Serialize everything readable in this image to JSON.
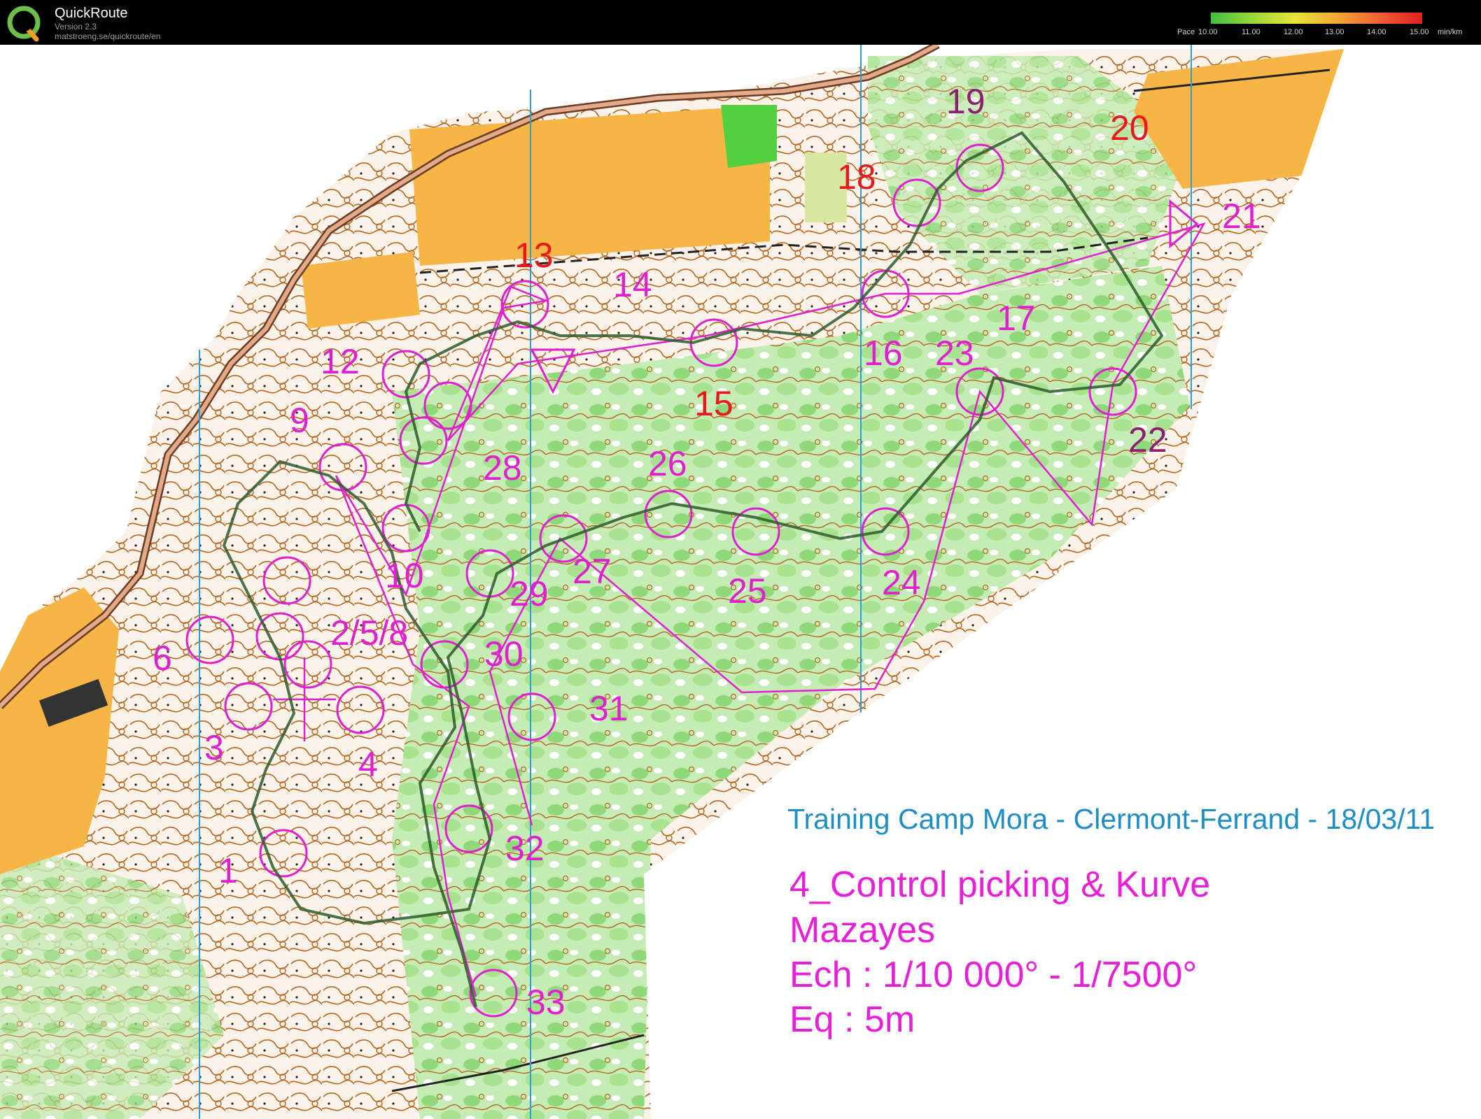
{
  "app": {
    "title": "QuickRoute",
    "version": "Version 2.3",
    "url": "matstroeng.se/quickroute/en"
  },
  "pace_legend": {
    "label": "Pace",
    "ticks": [
      "10.00",
      "11.00",
      "12.00",
      "13.00",
      "14.00",
      "15.00"
    ],
    "unit": "min/km",
    "colors": [
      "#3fbf3f",
      "#9bd93a",
      "#e8e23a",
      "#f5a637",
      "#f06030",
      "#e02020"
    ]
  },
  "map": {
    "title": "Training Camp Mora - Clermont-Ferrand - 18/03/11",
    "lines": [
      "4_Control picking & Kurve",
      "Mazayes",
      "Ech : 1/10 000° - 1/7500°",
      "Eq : 5m"
    ],
    "colors": {
      "course": "#e020d0",
      "route": "#2d5a2d",
      "forest": "#7ed46b",
      "field": "#f6b544",
      "contour": "#a0522d",
      "road": "#c47a5a",
      "meridian": "#2aa0d8"
    },
    "controls": [
      {
        "label": "1",
        "style": "ctl-num"
      },
      {
        "label": "2/5/8",
        "style": "ctl-num"
      },
      {
        "label": "3",
        "style": "ctl-num"
      },
      {
        "label": "4",
        "style": "ctl-num"
      },
      {
        "label": "6",
        "style": "ctl-num"
      },
      {
        "label": "9",
        "style": "ctl-num"
      },
      {
        "label": "10",
        "style": "ctl-num"
      },
      {
        "label": "12",
        "style": "ctl-num"
      },
      {
        "label": "13",
        "style": "ctl-num-red"
      },
      {
        "label": "14",
        "style": "ctl-num"
      },
      {
        "label": "15",
        "style": "ctl-num-red"
      },
      {
        "label": "16",
        "style": "ctl-num"
      },
      {
        "label": "17",
        "style": "ctl-num"
      },
      {
        "label": "18",
        "style": "ctl-num-red"
      },
      {
        "label": "19",
        "style": "ctl-num-dark"
      },
      {
        "label": "20",
        "style": "ctl-num-red"
      },
      {
        "label": "21",
        "style": "ctl-num"
      },
      {
        "label": "22",
        "style": "ctl-num-dark"
      },
      {
        "label": "23",
        "style": "ctl-num"
      },
      {
        "label": "24",
        "style": "ctl-num"
      },
      {
        "label": "25",
        "style": "ctl-num"
      },
      {
        "label": "26",
        "style": "ctl-num"
      },
      {
        "label": "27",
        "style": "ctl-num"
      },
      {
        "label": "28",
        "style": "ctl-num"
      },
      {
        "label": "29",
        "style": "ctl-num"
      },
      {
        "label": "30",
        "style": "ctl-num"
      },
      {
        "label": "31",
        "style": "ctl-num"
      },
      {
        "label": "32",
        "style": "ctl-num"
      },
      {
        "label": "33",
        "style": "ctl-num"
      }
    ]
  }
}
